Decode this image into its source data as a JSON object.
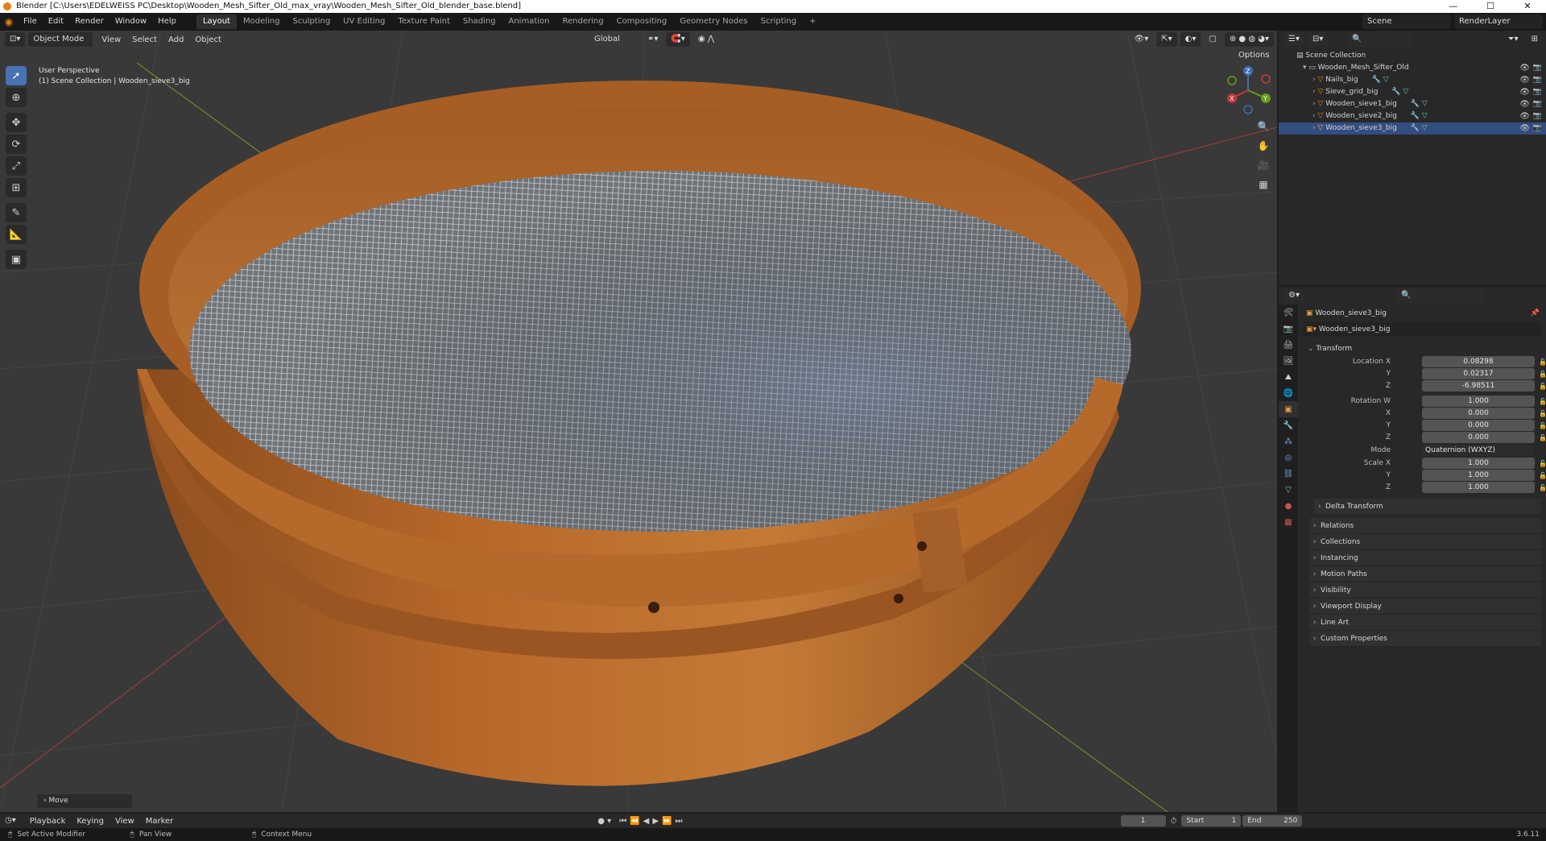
{
  "window": {
    "title": "Blender [C:\\Users\\EDELWEISS PC\\Desktop\\Wooden_Mesh_Sifter_Old_max_vray\\Wooden_Mesh_Sifter_Old_blender_base.blend]",
    "minimize": "—",
    "maximize": "☐",
    "close": "✕"
  },
  "menu": [
    "File",
    "Edit",
    "Render",
    "Window",
    "Help"
  ],
  "workspaces": [
    "Layout",
    "Modeling",
    "Sculpting",
    "UV Editing",
    "Texture Paint",
    "Shading",
    "Animation",
    "Rendering",
    "Compositing",
    "Geometry Nodes",
    "Scripting"
  ],
  "active_workspace": "Layout",
  "scene": {
    "name": "Scene",
    "view_layer": "RenderLayer"
  },
  "viewport": {
    "mode": "Object Mode",
    "menus": [
      "View",
      "Select",
      "Add",
      "Object"
    ],
    "orientation": "Global",
    "options": "Options",
    "info_line1": "User Perspective",
    "info_line2": "(1) Scene Collection | Wooden_sieve3_big",
    "last_op": "Move",
    "gizmo": {
      "x": "X",
      "y": "Y",
      "z": "Z"
    }
  },
  "outliner": {
    "root": "Scene Collection",
    "collection": "Wooden_Mesh_Sifter_Old",
    "objects": [
      "Nails_big",
      "Sieve_grid_big",
      "Wooden_sieve1_big",
      "Wooden_sieve2_big",
      "Wooden_sieve3_big"
    ],
    "selected": "Wooden_sieve3_big"
  },
  "properties": {
    "object_name": "Wooden_sieve3_big",
    "datablock": "Wooden_sieve3_big",
    "transform_header": "Transform",
    "location": {
      "label": "Location X",
      "x": "0.08298",
      "y": "0.02317",
      "z": "-6.98511"
    },
    "rotation": {
      "label": "Rotation W",
      "w": "1.000",
      "x": "0.000",
      "y": "0.000",
      "z": "0.000"
    },
    "mode_label": "Mode",
    "mode_value": "Quaternion (WXYZ)",
    "scale": {
      "label": "Scale X",
      "x": "1.000",
      "y": "1.000",
      "z": "1.000"
    },
    "axis_labels": {
      "y": "Y",
      "z": "Z",
      "x": "X"
    },
    "delta": "Delta Transform",
    "panels": [
      "Relations",
      "Collections",
      "Instancing",
      "Motion Paths",
      "Visibility",
      "Viewport Display",
      "Line Art",
      "Custom Properties"
    ]
  },
  "timeline": {
    "menus": [
      "Playback",
      "Keying",
      "View",
      "Marker"
    ],
    "current_frame": "1",
    "start_label": "Start",
    "start": "1",
    "end_label": "End",
    "end": "250"
  },
  "status": {
    "left": "Set Active Modifier",
    "middle": "Pan View",
    "right": "Context Menu",
    "version": "3.6.11"
  },
  "colors": {
    "accent": "#4772b3",
    "selected_row": "#334d80",
    "wood": "#b86d2e",
    "object_orange": "#e87d0d"
  }
}
